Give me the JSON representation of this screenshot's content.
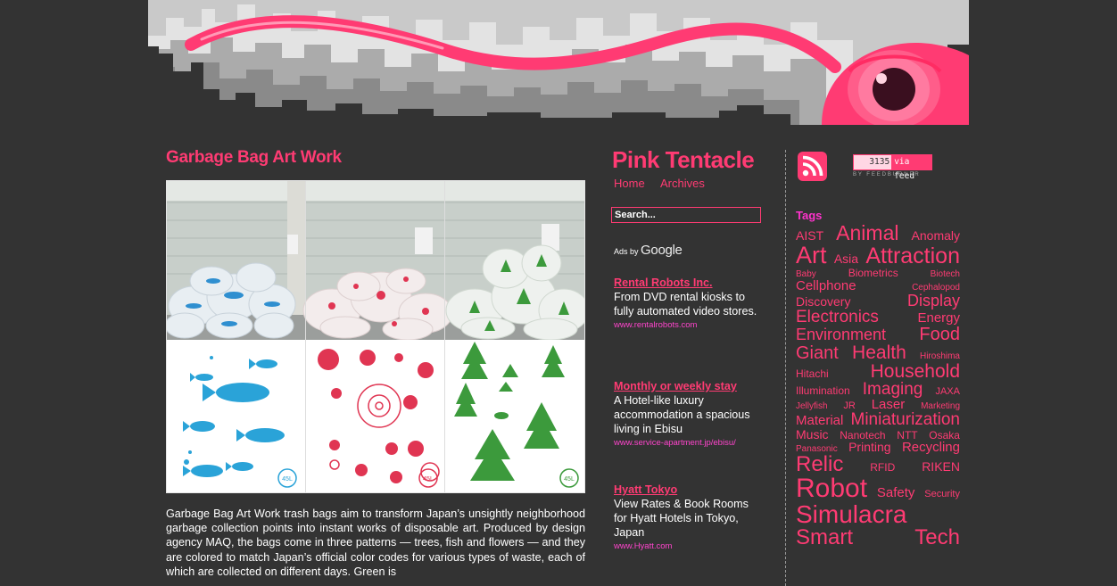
{
  "site": {
    "title": "Pink Tentacle",
    "nav": [
      {
        "label": "Home"
      },
      {
        "label": "Archives"
      }
    ],
    "search_placeholder": "Search...",
    "colors": {
      "accent": "#ff3b73",
      "background": "#333333",
      "tags_heading": "#ff33cc",
      "ad_url": "#ff44cc"
    }
  },
  "post": {
    "title": "Garbage Bag Art Work",
    "body": "Garbage Bag Art Work trash bags aim to transform Japan’s unsightly neighborhood garbage collection points into instant works of disposable art. Produced by design agency MAQ, the bags come in three patterns — trees, fish and flowers — and they are colored to match Japan’s official color codes for various types of waste, each of which are collected on different days. Green is",
    "photo": {
      "bag_label_size": "45L",
      "panels": [
        {
          "pattern": "fish",
          "color": "#2aa3d8"
        },
        {
          "pattern": "flowers",
          "color": "#e03552"
        },
        {
          "pattern": "trees",
          "color": "#3c9a3c"
        }
      ]
    }
  },
  "ads": {
    "ads_by": "Ads by",
    "ads_brand": "Google",
    "items": [
      {
        "title": "Rental Robots Inc.",
        "description": "From DVD rental kiosks to fully automated video stores.",
        "url": "www.rentalrobots.com"
      },
      {
        "title": "Monthly or weekly stay",
        "description": "A Hotel-like luxury accommodation a spacious living in Ebisu",
        "url": "www.service-apartment.jp/ebisu/"
      },
      {
        "title": "Hyatt Tokyo",
        "description": "View Rates & Book Rooms for Hyatt Hotels in Tokyo, Japan",
        "url": "www.Hyatt.com"
      }
    ]
  },
  "sidebar": {
    "rss_icon": "rss-feed-icon",
    "feed_counter": {
      "count": "3135",
      "label": "via feed",
      "provider": "BY FEEDBURNER"
    },
    "tags_heading": "Tags",
    "tag_lines": [
      [
        {
          "name": "AIST",
          "size": 14
        },
        {
          "name": "Animal",
          "size": 23
        },
        {
          "name": "Anomaly",
          "size": 14
        }
      ],
      [
        {
          "name": "Art",
          "size": 27
        },
        {
          "name": "Asia",
          "size": 14
        },
        {
          "name": "Attraction",
          "size": 25
        }
      ],
      [
        {
          "name": "Baby",
          "size": 10
        },
        {
          "name": "Biometrics",
          "size": 12
        },
        {
          "name": "Biotech",
          "size": 10
        }
      ],
      [
        {
          "name": "Cellphone",
          "size": 15
        },
        {
          "name": "Cephalopod",
          "size": 10
        }
      ],
      [
        {
          "name": "Discovery",
          "size": 14
        },
        {
          "name": "Display",
          "size": 18
        }
      ],
      [
        {
          "name": "Electronics",
          "size": 19
        },
        {
          "name": "Energy",
          "size": 15
        }
      ],
      [
        {
          "name": "Environment",
          "size": 18
        },
        {
          "name": "Food",
          "size": 20
        }
      ],
      [
        {
          "name": "Giant",
          "size": 20
        },
        {
          "name": "Health",
          "size": 21
        },
        {
          "name": "Hiroshima",
          "size": 10
        }
      ],
      [
        {
          "name": "Hitachi",
          "size": 12
        },
        {
          "name": "Household",
          "size": 21
        }
      ],
      [
        {
          "name": "Illumination",
          "size": 12
        },
        {
          "name": "Imaging",
          "size": 19
        },
        {
          "name": "JAXA",
          "size": 11
        }
      ],
      [
        {
          "name": "Jellyfish",
          "size": 10
        },
        {
          "name": "JR",
          "size": 11
        },
        {
          "name": "Laser",
          "size": 15
        },
        {
          "name": "Marketing",
          "size": 10
        }
      ],
      [
        {
          "name": "Material",
          "size": 15
        },
        {
          "name": "Miniaturization",
          "size": 19
        }
      ],
      [
        {
          "name": "Music",
          "size": 14
        },
        {
          "name": "Nanotech",
          "size": 12
        },
        {
          "name": "NTT",
          "size": 12
        },
        {
          "name": "Osaka",
          "size": 12
        }
      ],
      [
        {
          "name": "Panasonic",
          "size": 10
        },
        {
          "name": "Printing",
          "size": 14
        },
        {
          "name": "Recycling",
          "size": 15
        }
      ],
      [
        {
          "name": "Relic",
          "size": 24
        },
        {
          "name": "RFID",
          "size": 12
        },
        {
          "name": "RIKEN",
          "size": 14
        }
      ],
      [
        {
          "name": "Robot",
          "size": 30
        },
        {
          "name": "Safety",
          "size": 15
        },
        {
          "name": "Security",
          "size": 11
        }
      ],
      [
        {
          "name": "Simulacra",
          "size": 28
        }
      ],
      [
        {
          "name": "Smart",
          "size": 24
        },
        {
          "name": "Tech",
          "size": 24
        }
      ]
    ]
  }
}
